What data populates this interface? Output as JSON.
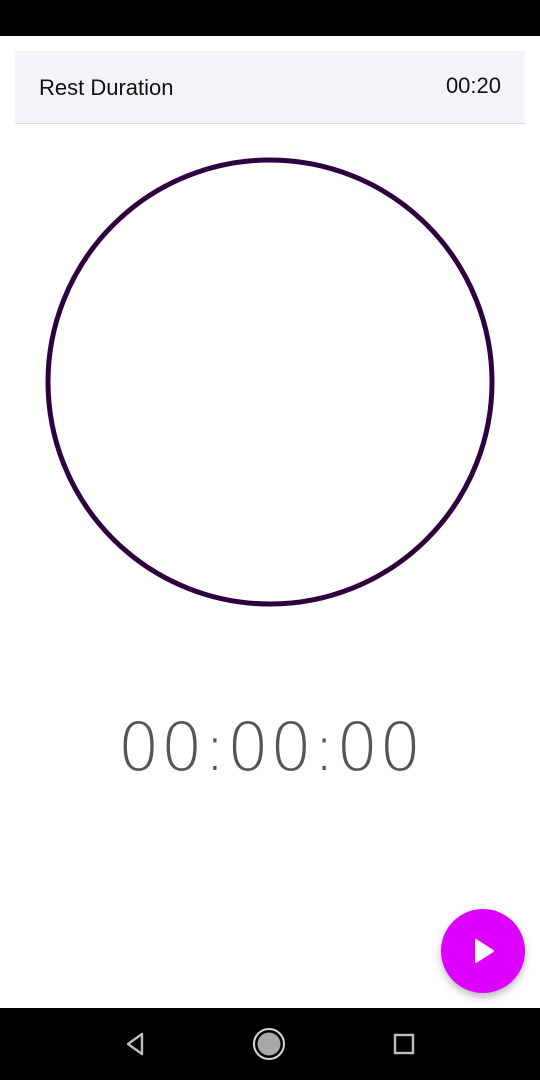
{
  "rest": {
    "label": "Rest Duration",
    "value": "00:20"
  },
  "timer": {
    "display": "00:00:00"
  },
  "icons": {
    "fab": "play-icon",
    "nav_back": "back-triangle-icon",
    "nav_home": "home-circle-icon",
    "nav_recent": "recent-apps-square-icon"
  },
  "colors": {
    "ring": "#2f0040",
    "fab": "#dd00ff",
    "timer_text": "#555555",
    "rest_row_bg": "#f3f4f7"
  }
}
